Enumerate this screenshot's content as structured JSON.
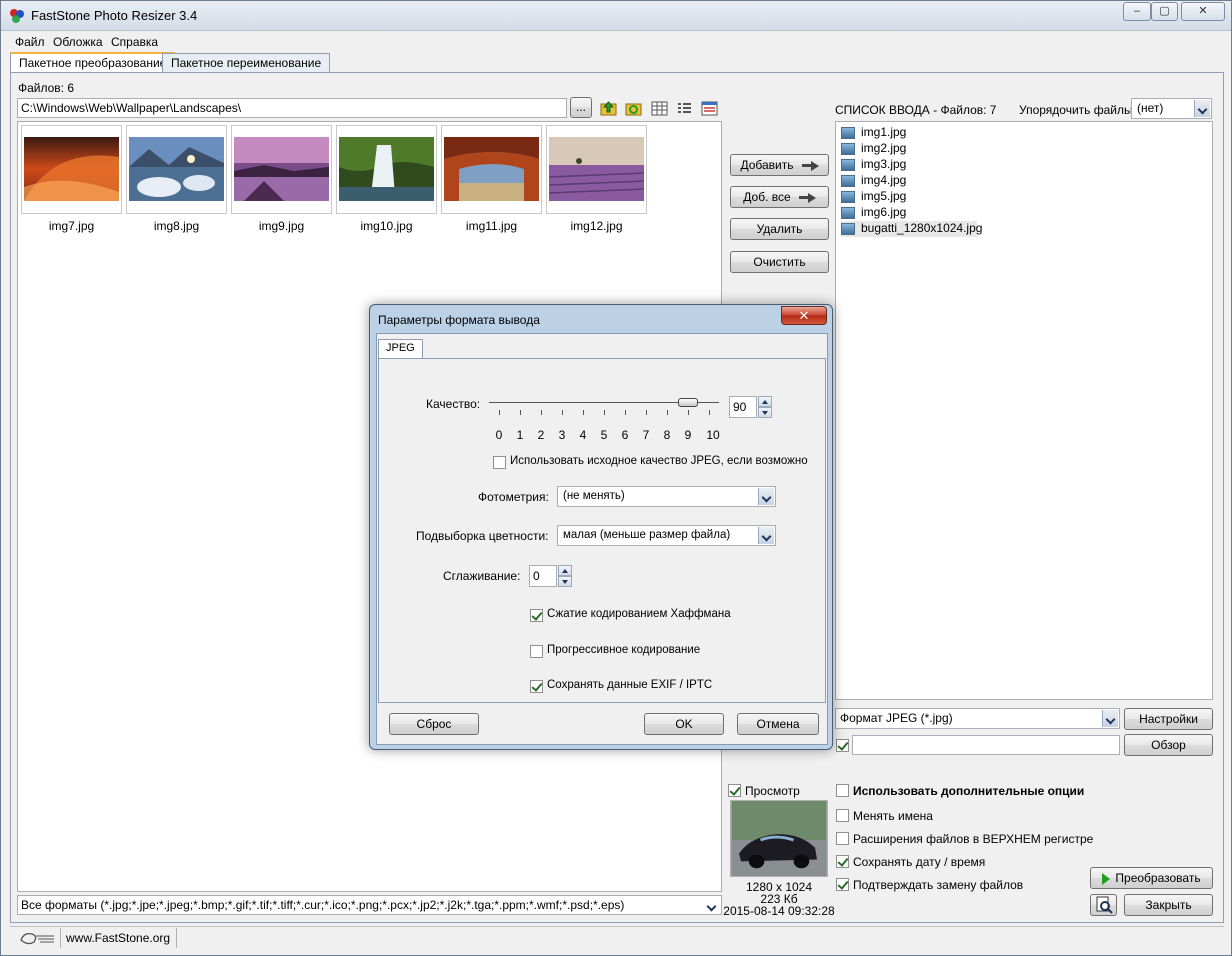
{
  "window": {
    "title": "FastStone Photo Resizer 3.4",
    "caption_buttons": [
      "–",
      "▢",
      "✕"
    ]
  },
  "menu": [
    "Файл",
    "Обложка",
    "Справка"
  ],
  "tabs": [
    {
      "label": "Пакетное преобразование",
      "active": true
    },
    {
      "label": "Пакетное переименование",
      "active": false
    }
  ],
  "left": {
    "files_count_label": "Файлов: 6",
    "path": "C:\\Windows\\Web\\Wallpaper\\Landscapes\\",
    "browse_label": "...",
    "thumbnails": [
      "img7.jpg",
      "img8.jpg",
      "img9.jpg",
      "img10.jpg",
      "img11.jpg",
      "img12.jpg"
    ],
    "filter": "Все форматы (*.jpg;*.jpe;*.jpeg;*.bmp;*.gif;*.tif;*.tiff;*.cur;*.ico;*.png;*.pcx;*.jp2;*.j2k;*.tga;*.ppm;*.wmf;*.psd;*.eps)"
  },
  "middle_buttons": {
    "add": "Добавить",
    "add_all": "Доб. все",
    "remove": "Удалить",
    "clear": "Очистить"
  },
  "right": {
    "input_list_label": "СПИСОК ВВОДА  -  Файлов: 7",
    "sort_label": "Упорядочить файлы:",
    "sort_value": "(нет)",
    "files": [
      "img1.jpg",
      "img2.jpg",
      "img3.jpg",
      "img4.jpg",
      "img5.jpg",
      "img6.jpg",
      "bugatti_1280x1024.jpg"
    ],
    "output_format": "Формат JPEG (*.jpg)",
    "settings_label": "Настройки",
    "browse_label": "Обзор",
    "output_folder": ""
  },
  "preview": {
    "label": "Просмотр",
    "checked": true,
    "dimensions": "1280 x 1024",
    "size": "223 Кб",
    "datetime": "2015-08-14 09:32:28"
  },
  "options": [
    {
      "label": "Использовать дополнительные опции",
      "checked": false,
      "bold": true
    },
    {
      "label": "Менять имена",
      "checked": false,
      "bold": false
    },
    {
      "label": "Расширения файлов в ВЕРХНЕМ регистре",
      "checked": false,
      "bold": false
    },
    {
      "label": "Сохранять дату / время",
      "checked": true,
      "bold": false
    },
    {
      "label": "Подтверждать замену файлов",
      "checked": true,
      "bold": false
    }
  ],
  "actions": {
    "convert": "Преобразовать",
    "close": "Закрыть"
  },
  "status": {
    "website": "www.FastStone.org"
  },
  "dialog": {
    "title": "Параметры формата вывода",
    "close": "✕",
    "tab": "JPEG",
    "quality_label": "Качество:",
    "quality_value": "90",
    "quality_fraction": 0.9,
    "scale": [
      "0",
      "1",
      "2",
      "3",
      "4",
      "5",
      "6",
      "7",
      "8",
      "9",
      "10"
    ],
    "use_original_label": "Использовать исходное качество JPEG, если возможно",
    "use_original_checked": false,
    "photometric_label": "Фотометрия:",
    "photometric_value": "(не менять)",
    "subsampling_label": "Подвыборка цветности:",
    "subsampling_value": "малая (меньше размер файла)",
    "smoothing_label": "Сглаживание:",
    "smoothing_value": "0",
    "huffman_label": "Сжатие кодированием Хаффмана",
    "huffman_checked": true,
    "progressive_label": "Прогрессивное кодирование",
    "progressive_checked": false,
    "exif_label": "Сохранять данные EXIF / IPTC",
    "exif_checked": true,
    "reset": "Сброс",
    "ok": "OK",
    "cancel": "Отмена"
  }
}
